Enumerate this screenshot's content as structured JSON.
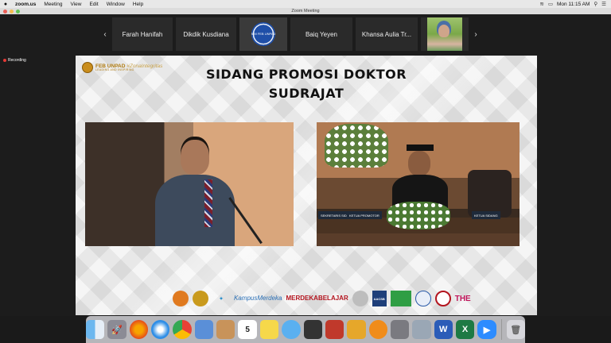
{
  "menubar": {
    "app_name": "zoom.us",
    "items": [
      "Meeting",
      "View",
      "Edit",
      "Window",
      "Help"
    ],
    "clock": "Mon 11:15 AM"
  },
  "window": {
    "title": "Zoom Meeting"
  },
  "participants": [
    {
      "name": "Farah Hanifah",
      "kind": "name"
    },
    {
      "name": "Dikdik Kusdiana",
      "kind": "name"
    },
    {
      "name": "",
      "kind": "badge",
      "badge_text": "SIM FEB UNPAD"
    },
    {
      "name": "Baiq Yeyen",
      "kind": "name"
    },
    {
      "name": "Khansa Aulia Tr...",
      "kind": "name"
    },
    {
      "name": "",
      "kind": "photo"
    }
  ],
  "nav": {
    "prev": "‹",
    "next": "›"
  },
  "recording": {
    "label": "Recording"
  },
  "slide": {
    "logo_main": "FEB UNPAD",
    "logo_tag": "#ZonaIntegritas",
    "logo_sub": "LEADING AND INSPIRING",
    "title_line1": "SIDANG PROMOSI DOKTOR",
    "title_line2": "SUDRAJAT",
    "nameplates": [
      "SEKRETARIS SIDANG",
      "KETUA PROMOTOR",
      "KETUA SIDANG"
    ]
  },
  "sponsors": {
    "campus_l1": "Kampus",
    "campus_l2": "Merdeka",
    "merdeka_l1": "MERDEKA",
    "merdeka_l2": "BELAJAR",
    "aacsb": "AACSB",
    "the": "THE"
  },
  "dock": {
    "icons": [
      "finder-icon",
      "launchpad-icon",
      "firefox-icon",
      "safari-icon",
      "chrome-icon",
      "preview-icon",
      "contacts-icon",
      "calendar-icon",
      "notes-icon",
      "messages-icon",
      "photo-booth-icon",
      "photos-icon",
      "pages-icon",
      "books-icon",
      "image-capture-icon",
      "screenshot-icon",
      "word-icon",
      "excel-icon",
      "zoom-icon",
      "trash-icon"
    ],
    "calendar_day": "5"
  }
}
